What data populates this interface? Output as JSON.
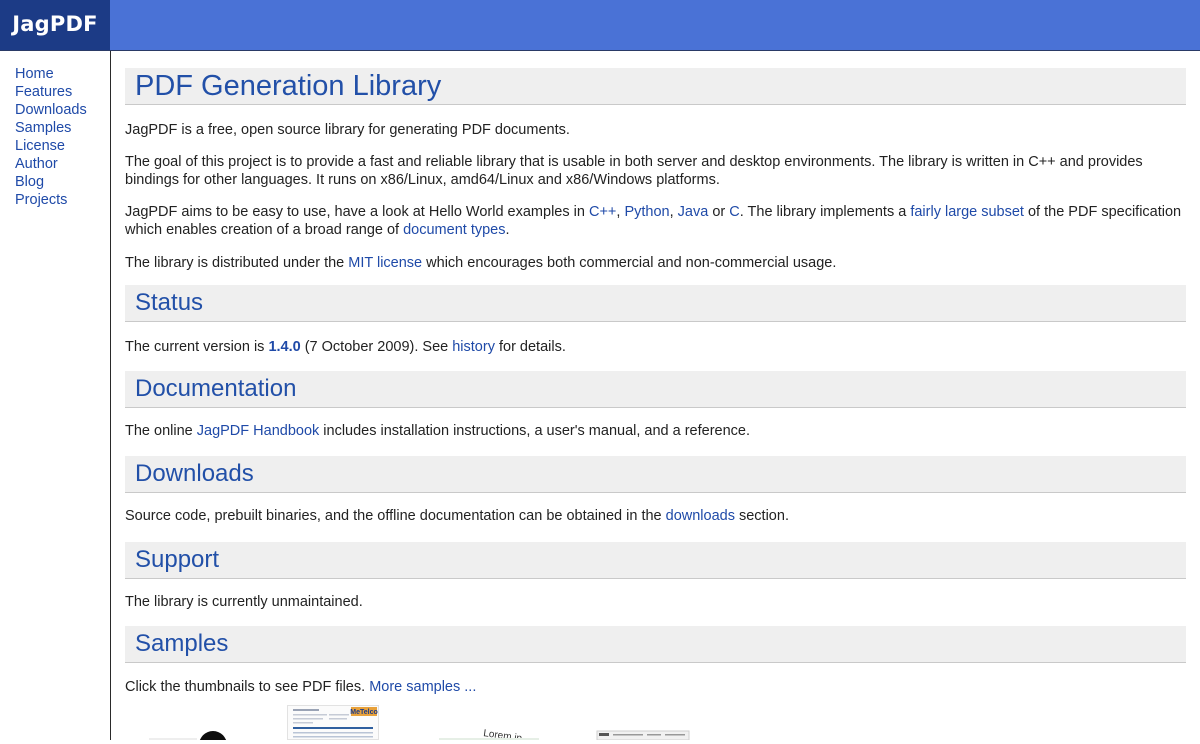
{
  "brand": {
    "name": "JagPDF"
  },
  "sidebar": {
    "items": [
      {
        "label": "Home"
      },
      {
        "label": "Features"
      },
      {
        "label": "Downloads"
      },
      {
        "label": "Samples"
      },
      {
        "label": "License"
      },
      {
        "label": "Author"
      },
      {
        "label": "Blog"
      },
      {
        "label": "Projects"
      }
    ]
  },
  "main": {
    "title": "PDF Generation Library",
    "intro": {
      "p1": "JagPDF is a free, open source library for generating PDF documents.",
      "p2": "The goal of this project is to provide a fast and reliable library that is usable in both server and desktop environments. The library is written in C++ and provides bindings for other languages. It runs on x86/Linux, amd64/Linux and x86/Windows platforms.",
      "p3": {
        "t1": "JagPDF aims to be easy to use, have a look at Hello World examples in ",
        "link_cpp": "C++",
        "sep1": ", ",
        "link_python": "Python",
        "sep2": ", ",
        "link_java": "Java",
        "sep3": " or ",
        "link_c": "C",
        "t2": ". The library implements a ",
        "link_subset": "fairly large subset",
        "t3": " of the PDF specification which enables creation of a broad range of ",
        "link_doctypes": "document types",
        "t4": "."
      },
      "p4": {
        "t1": "The library is distributed under the ",
        "link_mit": "MIT license",
        "t2": " which encourages both commercial and non-commercial usage."
      }
    },
    "status": {
      "heading": "Status",
      "t1": "The current version is ",
      "version": "1.4.0",
      "t2": " (7 October 2009). See ",
      "link_history": "history",
      "t3": " for details."
    },
    "documentation": {
      "heading": "Documentation",
      "t1": "The online ",
      "link_handbook": "JagPDF Handbook",
      "t2": " includes installation instructions, a user's manual, and a reference."
    },
    "downloads": {
      "heading": "Downloads",
      "t1": "Source code, prebuilt binaries, and the offline documentation can be obtained in the ",
      "link_downloads": "downloads",
      "t2": " section."
    },
    "support": {
      "heading": "Support",
      "t1": "The library is currently unmaintained."
    },
    "samples": {
      "heading": "Samples",
      "t1": "Click the thumbnails to see PDF files. ",
      "link_more": "More samples ..."
    }
  },
  "thumbnails": [
    {
      "icon": "sample-dark-graphic-thumbnail"
    },
    {
      "icon": "sample-invoice-thumbnail",
      "brand_text": "MeTelco"
    },
    {
      "icon": "sample-text-layout-thumbnail",
      "text": "Lorem ip"
    },
    {
      "icon": "sample-table-thumbnail"
    }
  ]
}
